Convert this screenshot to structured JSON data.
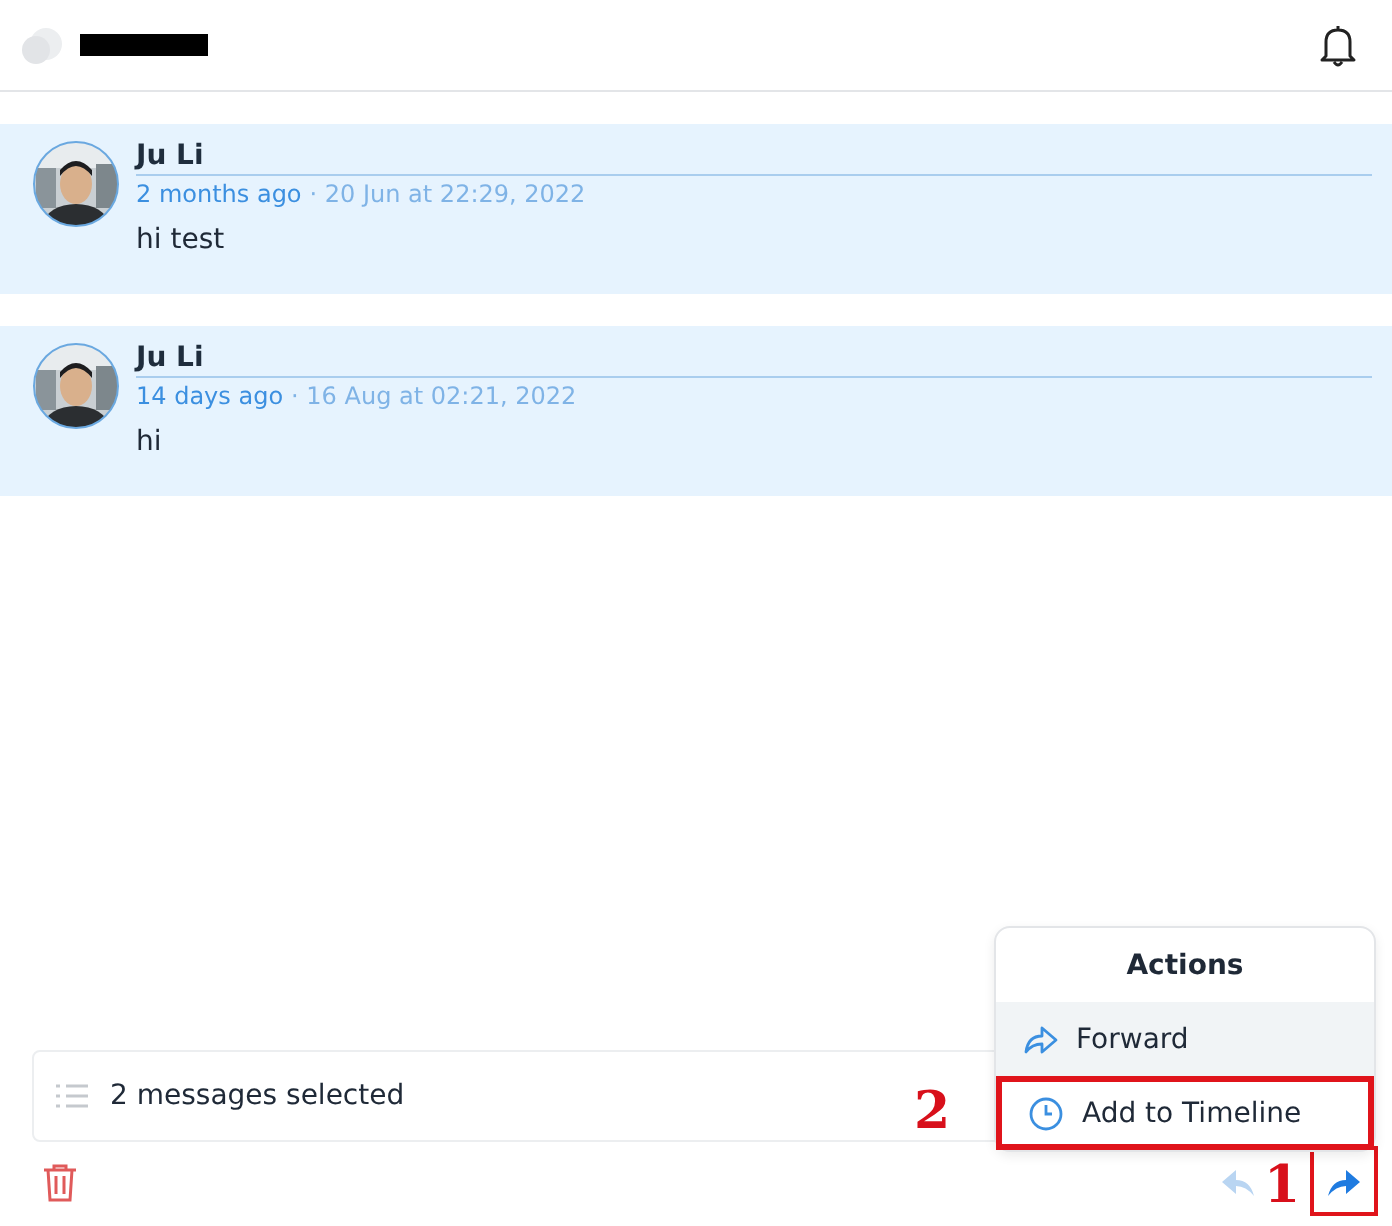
{
  "messages": [
    {
      "author": "Ju Li",
      "relative_time": "2 months ago",
      "timestamp": "· 20 Jun at 22:29, 2022",
      "text": "hi test"
    },
    {
      "author": "Ju Li",
      "relative_time": "14 days ago",
      "timestamp": "· 16 Aug at 02:21, 2022",
      "text": "hi"
    }
  ],
  "selection_bar": {
    "label": "2 messages selected"
  },
  "actions_menu": {
    "title": "Actions",
    "items": [
      {
        "kind": "forward",
        "label": "Forward",
        "selected": true
      },
      {
        "kind": "timeline",
        "label": "Add to Timeline",
        "selected": false
      }
    ]
  },
  "menu_annotation": {
    "label": "2"
  },
  "button_annotation": {
    "label": "1"
  }
}
